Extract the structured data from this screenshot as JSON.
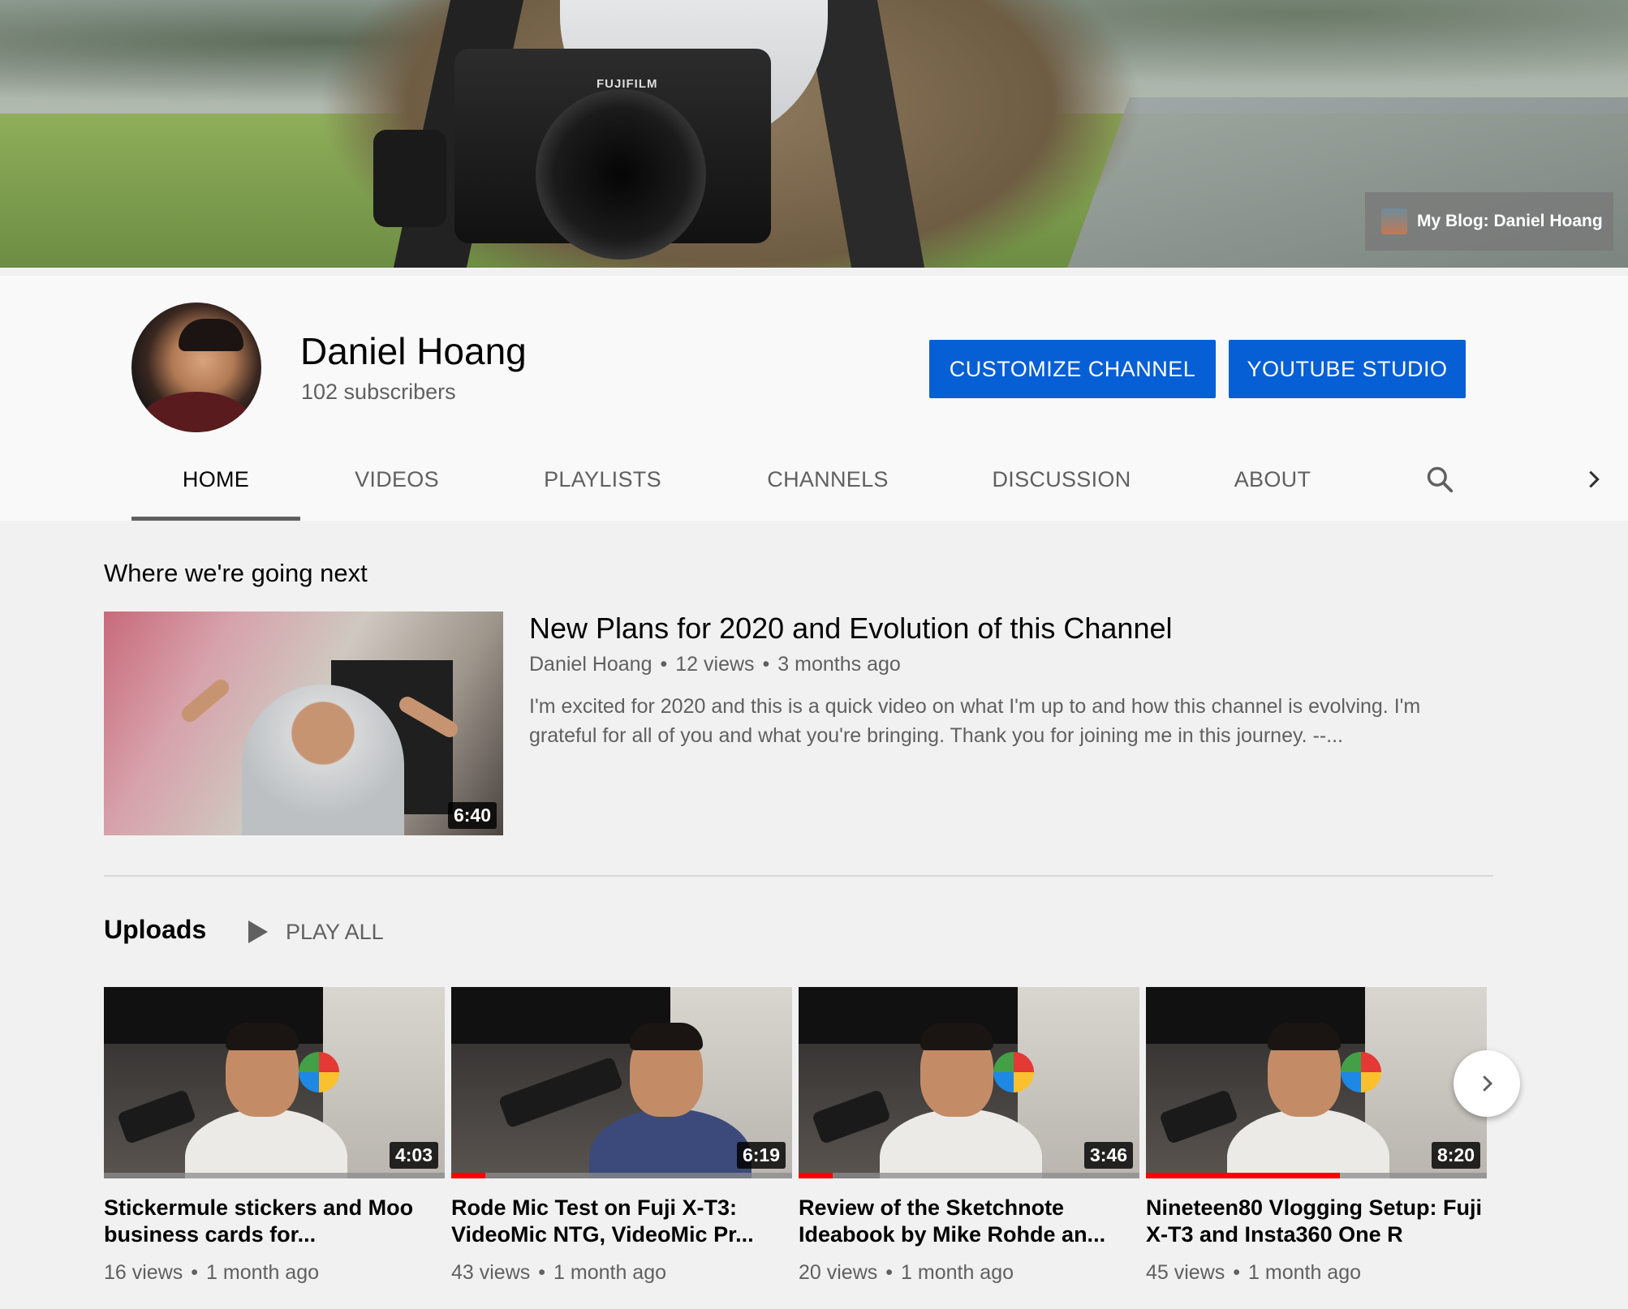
{
  "banner": {
    "camera_brand": "FUJIFILM",
    "link_label": "My Blog: Daniel Hoang"
  },
  "channel": {
    "name": "Daniel Hoang",
    "subscribers": "102 subscribers",
    "customize_label": "CUSTOMIZE CHANNEL",
    "studio_label": "YOUTUBE STUDIO"
  },
  "tabs": [
    {
      "label": "HOME",
      "active": true
    },
    {
      "label": "VIDEOS"
    },
    {
      "label": "PLAYLISTS"
    },
    {
      "label": "CHANNELS"
    },
    {
      "label": "DISCUSSION"
    },
    {
      "label": "ABOUT"
    }
  ],
  "icons": {
    "search": "search-icon",
    "next": "chevron-right-icon",
    "play": "play-icon"
  },
  "featured": {
    "section_title": "Where we're going next",
    "title": "New Plans for 2020 and Evolution of this Channel",
    "author": "Daniel Hoang",
    "views": "12 views",
    "age": "3 months ago",
    "duration": "6:40",
    "description": "I'm excited for 2020 and this is a quick video on what I'm up to and how this channel is evolving. I'm grateful for all of you and what you're bringing. Thank you for joining me in this journey. --..."
  },
  "uploads": {
    "title": "Uploads",
    "play_all": "PLAY ALL",
    "videos": [
      {
        "title": "Stickermule stickers and Moo business cards for...",
        "views": "16 views",
        "age": "1 month ago",
        "duration": "4:03",
        "watched_fraction": 0
      },
      {
        "title": "Rode Mic Test on Fuji X-T3: VideoMic NTG, VideoMic Pr...",
        "views": "43 views",
        "age": "1 month ago",
        "duration": "6:19",
        "watched_fraction": 0.1
      },
      {
        "title": "Review of the Sketchnote Ideabook by Mike Rohde an...",
        "views": "20 views",
        "age": "1 month ago",
        "duration": "3:46",
        "watched_fraction": 0.1
      },
      {
        "title": "Nineteen80 Vlogging Setup: Fuji X-T3 and Insta360 One R",
        "views": "45 views",
        "age": "1 month ago",
        "duration": "8:20",
        "watched_fraction": 0.57
      }
    ]
  },
  "colors": {
    "accent": "#065fd4",
    "progress": "#ff0000",
    "text_primary": "#030303",
    "text_secondary": "#606060"
  }
}
